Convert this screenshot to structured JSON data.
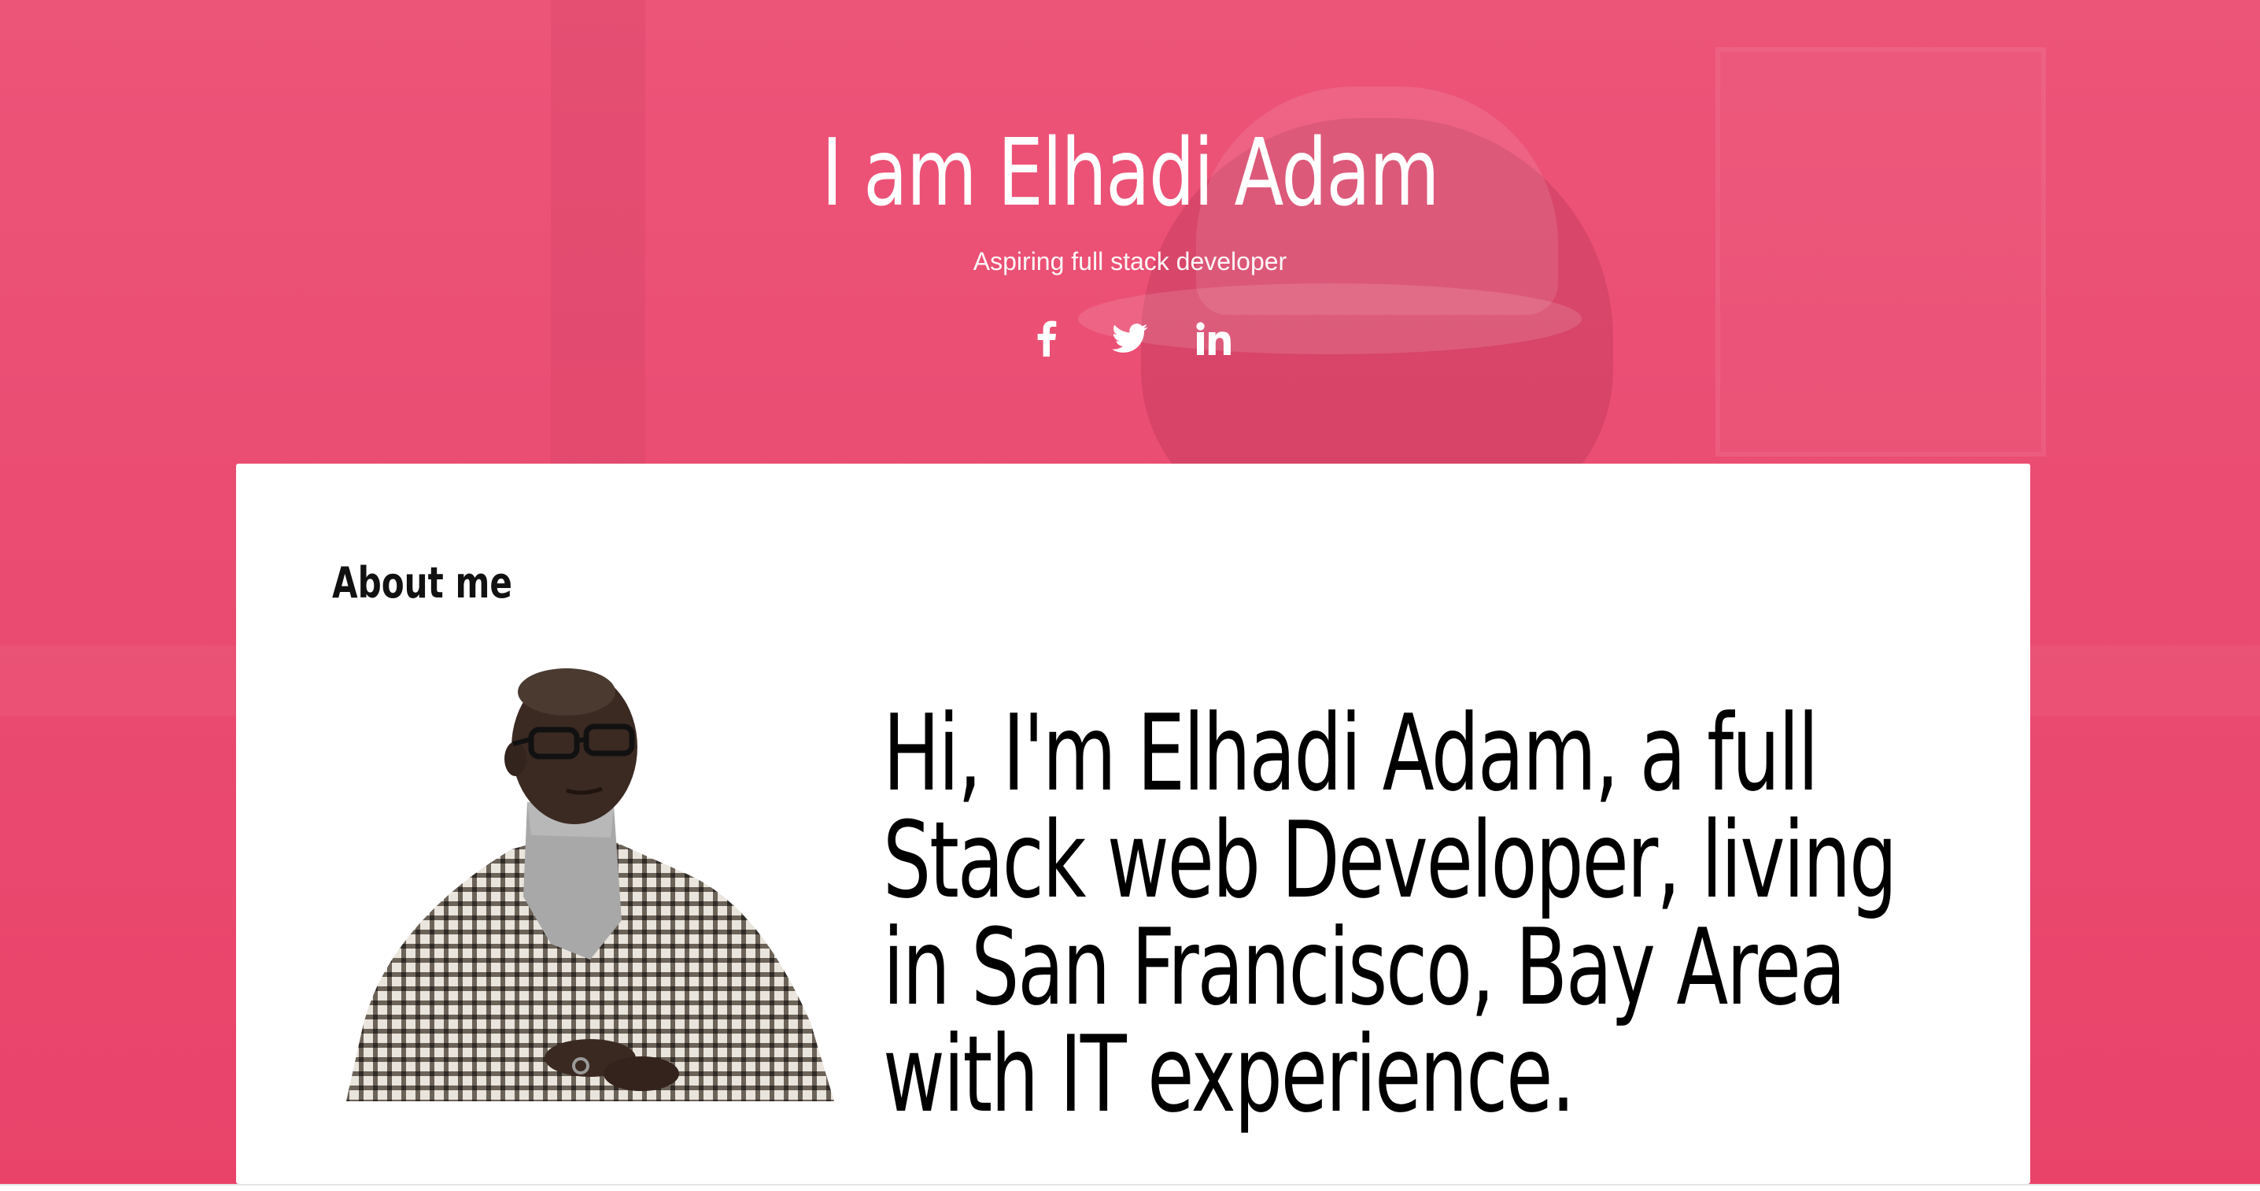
{
  "hero": {
    "title": "I am Elhadi Adam",
    "subtitle": "Aspiring full stack developer",
    "socials": [
      {
        "name": "facebook-icon"
      },
      {
        "name": "twitter-icon"
      },
      {
        "name": "linkedin-icon"
      }
    ],
    "accent_color": "#ec5478"
  },
  "about": {
    "heading": "About me",
    "bio": "Hi, I'm Elhadi Adam, a full Stack web Developer, living in San Francisco, Bay Area with IT experience."
  }
}
